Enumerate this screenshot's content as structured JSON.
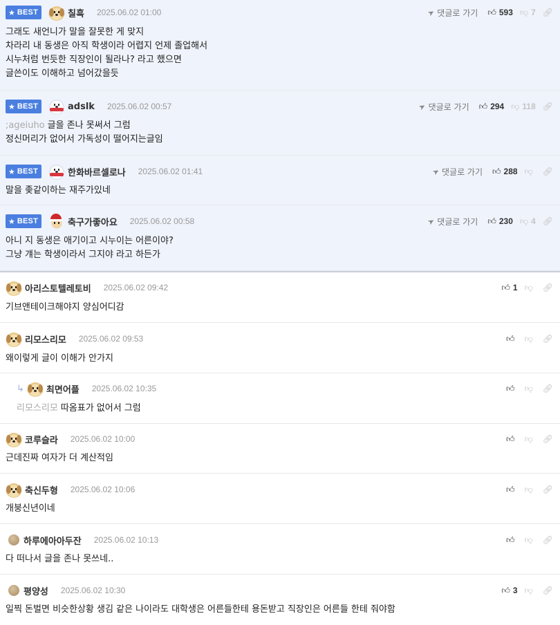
{
  "ui": {
    "best_label": "BEST",
    "goto_label": "댓글로 가기",
    "accent": "#4a7fe0"
  },
  "comments": [
    {
      "best": true,
      "avatar": "dog-avatar",
      "nickname": "칠흑",
      "date": "2025.06.02 01:00",
      "likes": "593",
      "dislikes": "7",
      "lines": [
        "그래도 새언니가 말을 잘못한 게 맞지",
        "차라리 내 동생은 아직 학생이라 어렵지 언제 졸업해서",
        "시누처럼 번듯한 직장인이 될라나? 라고 했으면",
        "글쓴이도 이해하고 넘어갔을듯"
      ]
    },
    {
      "best": true,
      "avatar": "bear-avatar",
      "nickname": "adslk",
      "date": "2025.06.02 00:57",
      "likes": "294",
      "dislikes": "118",
      "mention": ";ageiuho",
      "lines": [
        "글을 존나 못써서 그럼",
        "정신머리가 없어서 가독성이 떨어지는글임"
      ]
    },
    {
      "best": true,
      "avatar": "bear-avatar",
      "nickname": "한화바르셀로나",
      "date": "2025.06.02 01:41",
      "likes": "288",
      "dislikes": "",
      "lines": [
        "말을 좆같이하는 재주가있네"
      ]
    },
    {
      "best": true,
      "avatar": "santa-avatar",
      "nickname": "축구가좋아요",
      "date": "2025.06.02 00:58",
      "likes": "230",
      "dislikes": "4",
      "lines": [
        "아니 지 동생은 애기이고 시누이는 어른이야?",
        "그냥 걔는 학생이라서 그지야 라고 하든가"
      ]
    },
    {
      "best": false,
      "avatar": "dog-avatar",
      "nickname": "아리스토텔레토비",
      "date": "2025.06.02 09:42",
      "likes": "1",
      "dislikes": "",
      "lines": [
        "기브앤테이크해야지 양심어디감"
      ]
    },
    {
      "best": false,
      "avatar": "dog-avatar",
      "nickname": "리모스리모",
      "date": "2025.06.02 09:53",
      "likes": "",
      "dislikes": "",
      "lines": [
        "왜이렇게 글이 이해가 안가지"
      ]
    },
    {
      "best": false,
      "reply": true,
      "avatar": "dog-avatar",
      "nickname": "최면어플",
      "date": "2025.06.02 10:35",
      "likes": "",
      "dislikes": "",
      "mention": "리모스리모",
      "lines": [
        "따옴표가 없어서 그럼"
      ]
    },
    {
      "best": false,
      "avatar": "dog-avatar",
      "nickname": "코루슬라",
      "date": "2025.06.02 10:00",
      "likes": "",
      "dislikes": "",
      "lines": [
        "근데진짜 여자가 더 계산적임"
      ]
    },
    {
      "best": false,
      "avatar": "dog-avatar",
      "nickname": "축신두형",
      "date": "2025.06.02 10:06",
      "likes": "",
      "dislikes": "",
      "lines": [
        "개붕신년이네"
      ]
    },
    {
      "best": false,
      "avatar": "ball-avatar",
      "nickname": "하루에아아두잔",
      "date": "2025.06.02 10:13",
      "likes": "",
      "dislikes": "",
      "lines": [
        "다 떠나서 글을 존나 못쓰네.."
      ]
    },
    {
      "best": false,
      "avatar": "ball-avatar",
      "nickname": "평양성",
      "date": "2025.06.02 10:30",
      "likes": "3",
      "dislikes": "",
      "lines": [
        "일찍 돈벌면 비슷한상황 생김 같은 나이라도 대학생은 어른들한테 용돈받고 직장인은 어른들 한테 줘야함"
      ]
    }
  ]
}
